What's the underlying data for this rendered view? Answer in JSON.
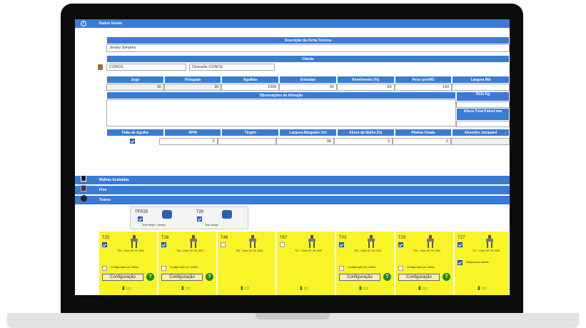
{
  "header": {
    "title": "Dados Gerais"
  },
  "ficha": {
    "label": "Descrição da Ficha Técnica",
    "value": "Jersey Simples"
  },
  "cliente": {
    "label": "Cliente",
    "code": "CONCE",
    "name": "Distraide CONCE"
  },
  "specs": {
    "headers": [
      "Jogo",
      "Polegada",
      "Agulhas",
      "Entradas",
      "Rendimento (%)",
      "Peso grm/M2",
      "Largura Rib"
    ],
    "values": [
      "16",
      "30",
      "1000",
      "90",
      "83",
      "160",
      ""
    ]
  },
  "observacoes": {
    "label": "Observações de Afinação",
    "rolo_label": "Rolo Kg",
    "altura_label": "Altura Total Painel mm"
  },
  "extras": {
    "headers": [
      "Falta de Agulha",
      "RPM",
      "Tingim",
      "Largura Margador Cm",
      "Altura da Malha (%)",
      "Platina Usada",
      "Desenho Jacquard"
    ],
    "values": [
      "",
      "0",
      "",
      "0E",
      "0",
      "0",
      ""
    ]
  },
  "sections": {
    "malhas": "Malhas Acabadas",
    "fios": "Fios",
    "teares": "Teares"
  },
  "tear_types": [
    {
      "code": "TFP25",
      "label": "Tear Pelipe + Jersey"
    },
    {
      "code": "T20",
      "label": "Tear Jersey"
    }
  ],
  "tiles": [
    {
      "name": "T25",
      "checked": true,
      "desc": "T25 - Diam 30\" 90 1000",
      "config_checked": false,
      "config_label": "Configuração por defeito",
      "button": "Configuração"
    },
    {
      "name": "T28",
      "checked": true,
      "desc": "T28 - Diam 30\" 90 1000",
      "config_checked": false,
      "config_label": "Configuração por defeito",
      "button": "Configuração"
    },
    {
      "name": "T46",
      "checked": false,
      "desc": "T46 - Diam 30\" 90 1000",
      "config_checked": false,
      "config_label": "",
      "button": ""
    },
    {
      "name": "T67",
      "checked": false,
      "desc": "T67 - Diam 30\" 90 1000",
      "config_checked": false,
      "config_label": "",
      "button": ""
    },
    {
      "name": "T03",
      "checked": true,
      "desc": "T03 - Diam 30\" 90 1000",
      "config_checked": false,
      "config_label": "Configuração por defeito",
      "button": "Configuração"
    },
    {
      "name": "T25",
      "checked": true,
      "desc": "T26 - Diam 30\" 90 1000",
      "config_checked": false,
      "config_label": "Configuração por defeito",
      "button": "Configuração"
    },
    {
      "name": "T27",
      "checked": true,
      "desc": "T27 - Diam 30\" 90 1000",
      "config_checked": true,
      "config_label": "Máquina por defeito",
      "button": ""
    }
  ]
}
